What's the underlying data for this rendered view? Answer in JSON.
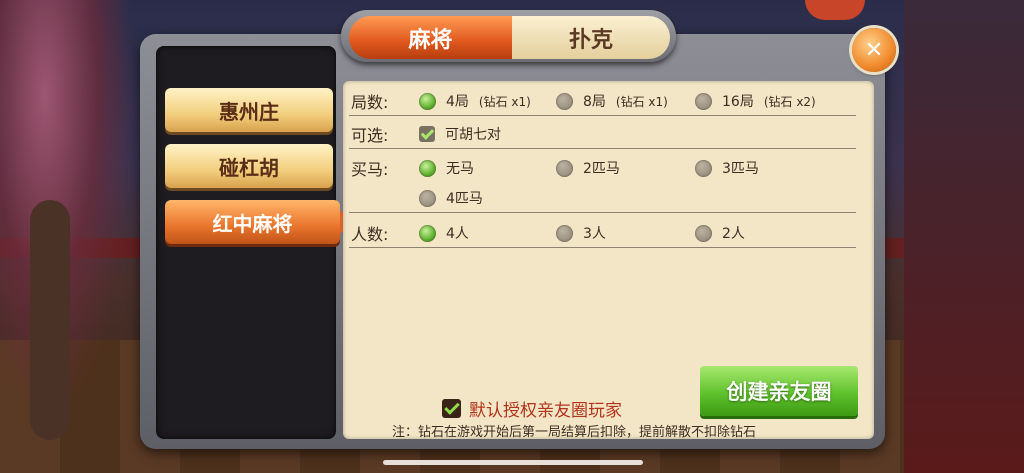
{
  "tabs": [
    {
      "label": "麻将",
      "active": true
    },
    {
      "label": "扑克",
      "active": false
    }
  ],
  "close_icon": "close-x-icon",
  "sidebar": {
    "items": [
      {
        "label": "惠州庄",
        "active": false
      },
      {
        "label": "碰杠胡",
        "active": false
      },
      {
        "label": "红中麻将",
        "active": true
      }
    ]
  },
  "rounds": {
    "label": "局数:",
    "options": [
      {
        "text": "4局",
        "cost": "(钻石 x1)",
        "selected": true
      },
      {
        "text": "8局",
        "cost": "(钻石 x1)",
        "selected": false
      },
      {
        "text": "16局",
        "cost": "(钻石 x2)",
        "selected": false
      }
    ]
  },
  "optional": {
    "label": "可选:",
    "options": [
      {
        "text": "可胡七对",
        "checked": true
      }
    ]
  },
  "buy_horse": {
    "label": "买马:",
    "options": [
      {
        "text": "无马",
        "selected": true
      },
      {
        "text": "2匹马",
        "selected": false
      },
      {
        "text": "3匹马",
        "selected": false
      },
      {
        "text": "4匹马",
        "selected": false
      }
    ]
  },
  "players": {
    "label": "人数:",
    "options": [
      {
        "text": "4人",
        "selected": true
      },
      {
        "text": "3人",
        "selected": false
      },
      {
        "text": "2人",
        "selected": false
      }
    ]
  },
  "authorize": {
    "text": "默认授权亲友圈玩家",
    "checked": true
  },
  "create_button": "创建亲友圈",
  "note": "注：钻石在游戏开始后第一局结算后扣除，提前解散不扣除钻石",
  "colors": {
    "accent_orange": "#e0581e",
    "selected_green": "#5cb02a",
    "warning_red": "#b3331d"
  }
}
